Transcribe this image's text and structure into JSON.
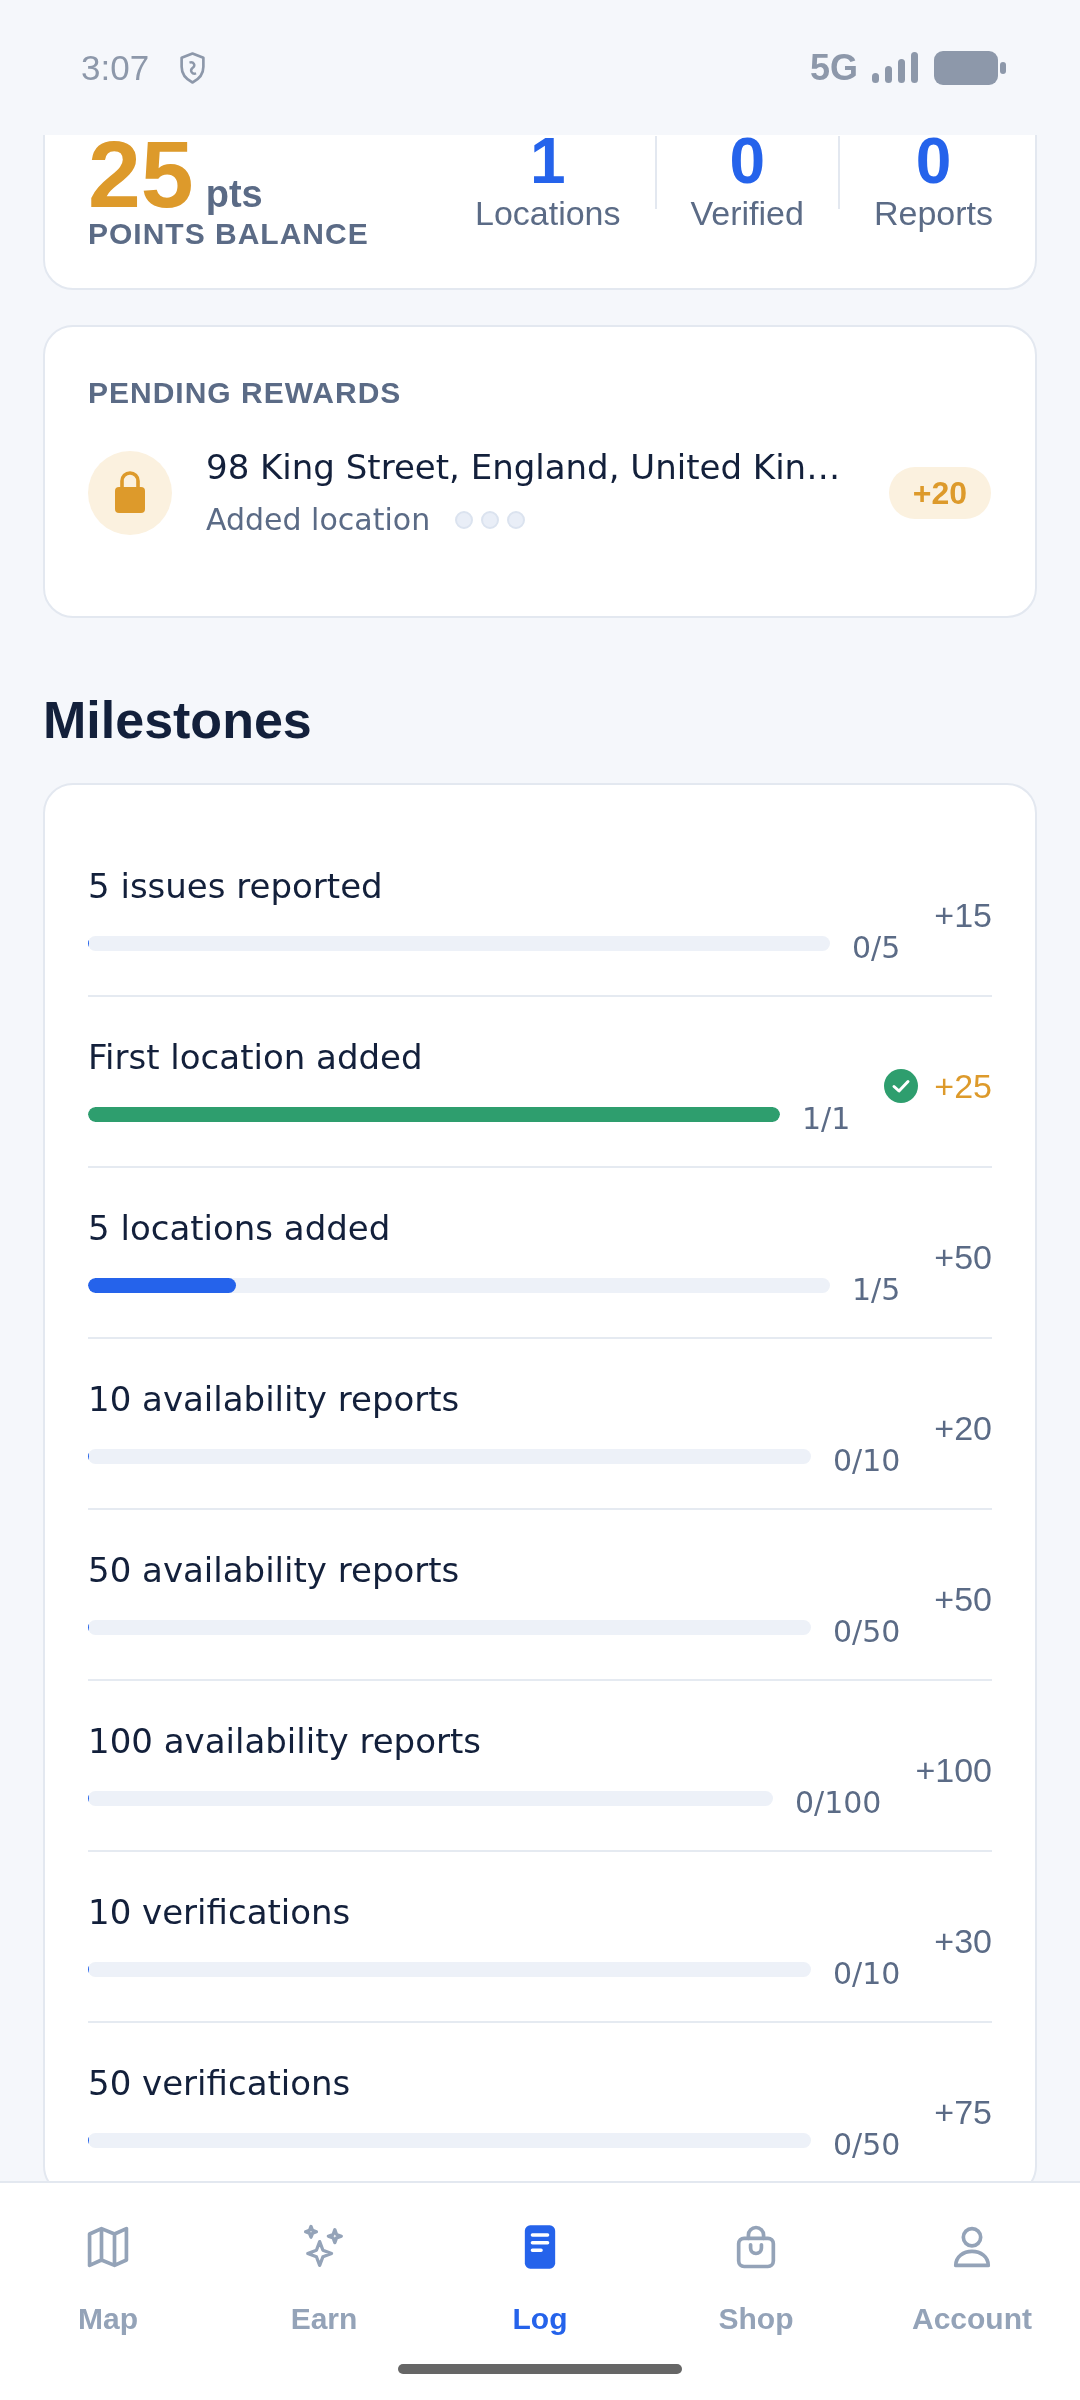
{
  "status_bar": {
    "time": "3:07",
    "network": "5G"
  },
  "points": {
    "value": "25",
    "unit": "pts",
    "label": "POINTS BALANCE"
  },
  "stats": [
    {
      "value": "1",
      "label": "Locations"
    },
    {
      "value": "0",
      "label": "Verified"
    },
    {
      "value": "0",
      "label": "Reports"
    }
  ],
  "pending_rewards": {
    "title": "PENDING REWARDS",
    "items": [
      {
        "address": "98 King Street, England, United Kin…",
        "activity": "Added location",
        "verification_dots": [
          {
            "filled": false
          },
          {
            "filled": false
          },
          {
            "filled": false
          }
        ],
        "reward": "+20"
      }
    ]
  },
  "milestones": {
    "title": "Milestones",
    "items": [
      {
        "name": "5 issues reported",
        "progress": "0/5",
        "level": 0,
        "reward": "+15",
        "completed": false
      },
      {
        "name": "First location added",
        "progress": "1/1",
        "level": 1,
        "reward": "+25",
        "completed": true
      },
      {
        "name": "5 locations added",
        "progress": "1/5",
        "level": 0.2,
        "reward": "+50",
        "completed": false
      },
      {
        "name": "10 availability reports",
        "progress": "0/10",
        "level": 0,
        "reward": "+20",
        "completed": false
      },
      {
        "name": "50 availability reports",
        "progress": "0/50",
        "level": 0,
        "reward": "+50",
        "completed": false
      },
      {
        "name": "100 availability reports",
        "progress": "0/100",
        "level": 0,
        "reward": "+100",
        "completed": false
      },
      {
        "name": "10 verifications",
        "progress": "0/10",
        "level": 0,
        "reward": "+30",
        "completed": false
      },
      {
        "name": "50 verifications",
        "progress": "0/50",
        "level": 0,
        "reward": "+75",
        "completed": false
      }
    ]
  },
  "bottom_nav": [
    {
      "label": "Map",
      "selected": false
    },
    {
      "label": "Earn",
      "selected": false
    },
    {
      "label": "Log",
      "selected": true
    },
    {
      "label": "Shop",
      "selected": false
    },
    {
      "label": "Account",
      "selected": false
    }
  ]
}
